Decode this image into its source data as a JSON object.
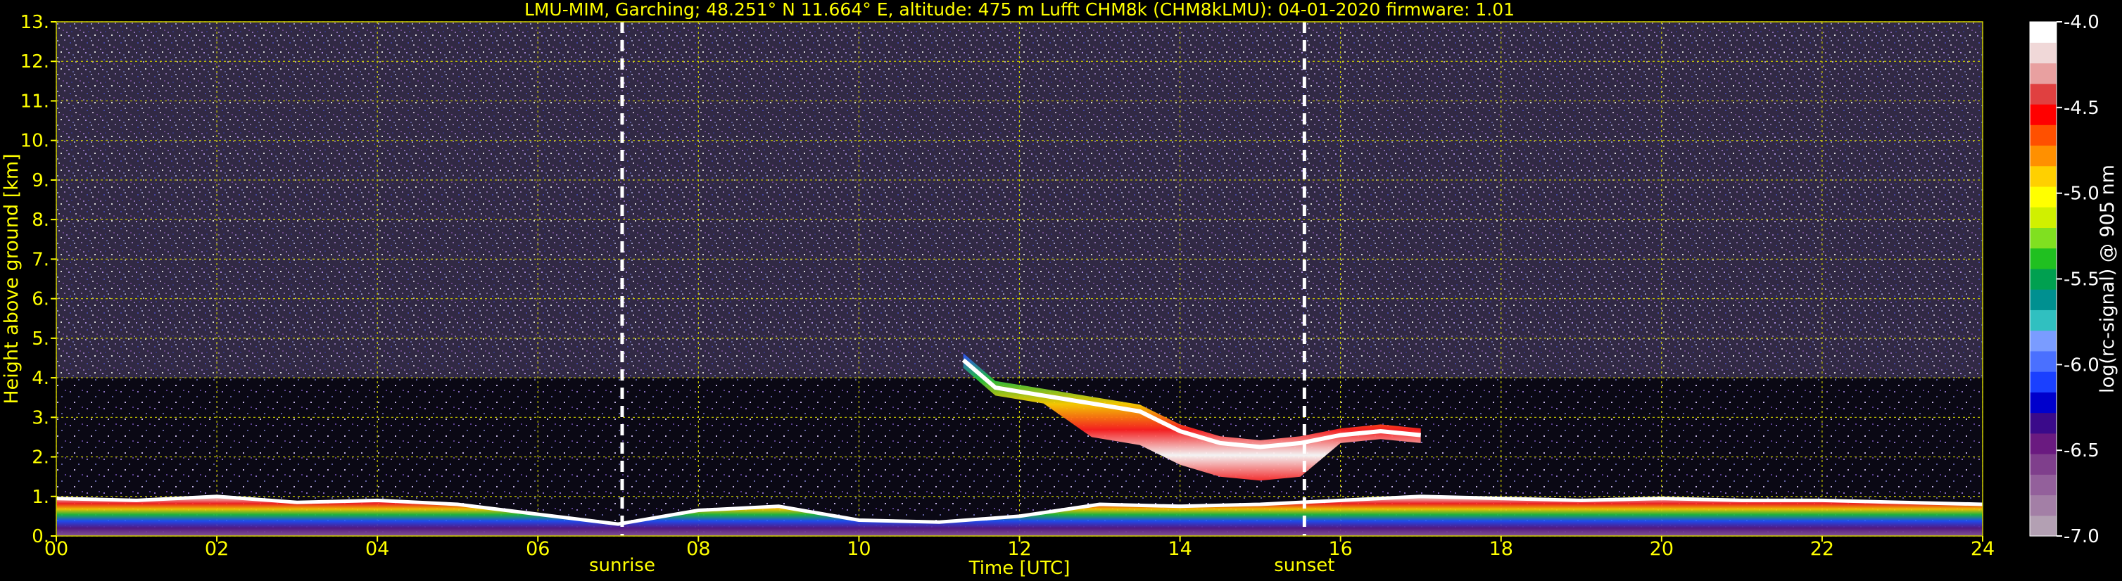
{
  "chart_data": {
    "type": "heatmap",
    "title": "LMU-MIM, Garching; 48.251° N 11.664° E, altitude: 475 m    Lufft CHM8k (CHM8kLMU): 04-01-2020    firmware: 1.01",
    "xlabel": "Time [UTC]",
    "ylabel": "Height above ground [km]",
    "xlim": [
      0,
      24
    ],
    "ylim": [
      0,
      13
    ],
    "x_ticks": [
      "00",
      "02",
      "04",
      "06",
      "08",
      "10",
      "12",
      "14",
      "16",
      "18",
      "20",
      "22",
      "24"
    ],
    "y_ticks": [
      "0.",
      "1.",
      "2.",
      "3.",
      "4.",
      "5.",
      "6.",
      "7.",
      "8.",
      "9.",
      "10.",
      "11.",
      "12.",
      "13."
    ],
    "grid": true,
    "grid_color": "#cccc00",
    "events": [
      {
        "label": "sunrise",
        "time": 7.05
      },
      {
        "label": "sunset",
        "time": 15.55
      }
    ],
    "colorbar": {
      "label": "log(rc-signal) @ 905 nm",
      "ticks": [
        "-4.0",
        "-4.5",
        "-5.0",
        "-5.5",
        "-6.0",
        "-6.5",
        "-7.0"
      ],
      "range": [
        -7.0,
        -4.0
      ],
      "colors": [
        "#b3a0b3",
        "#a37fa6",
        "#93609b",
        "#7f3f8c",
        "#6a1a80",
        "#3a0a8a",
        "#0000cc",
        "#1a40ff",
        "#4a70ff",
        "#7a9cff",
        "#30c0c0",
        "#009090",
        "#00a050",
        "#20c020",
        "#80e020",
        "#d0f000",
        "#ffff00",
        "#ffd000",
        "#ff9000",
        "#ff5000",
        "#ff0000",
        "#e04040",
        "#e8a0a0",
        "#f0d8d8",
        "#ffffff"
      ]
    },
    "boundary_layer_top_km": [
      [
        0.0,
        0.95
      ],
      [
        1.0,
        0.9
      ],
      [
        2.0,
        1.0
      ],
      [
        3.0,
        0.85
      ],
      [
        4.0,
        0.9
      ],
      [
        5.0,
        0.8
      ],
      [
        6.0,
        0.55
      ],
      [
        7.0,
        0.3
      ],
      [
        8.0,
        0.65
      ],
      [
        9.0,
        0.75
      ],
      [
        10.0,
        0.4
      ],
      [
        11.0,
        0.35
      ],
      [
        12.0,
        0.5
      ],
      [
        13.0,
        0.8
      ],
      [
        14.0,
        0.75
      ],
      [
        15.0,
        0.8
      ],
      [
        16.0,
        0.9
      ],
      [
        17.0,
        1.0
      ],
      [
        18.0,
        0.95
      ],
      [
        19.0,
        0.9
      ],
      [
        20.0,
        0.95
      ],
      [
        21.0,
        0.9
      ],
      [
        22.0,
        0.9
      ],
      [
        23.0,
        0.85
      ],
      [
        24.0,
        0.8
      ]
    ],
    "cloud_layer_km": [
      [
        11.3,
        4.5
      ],
      [
        11.7,
        3.8
      ],
      [
        12.3,
        3.6
      ],
      [
        12.9,
        3.4
      ],
      [
        13.5,
        3.2
      ],
      [
        14.0,
        2.7
      ],
      [
        14.5,
        2.4
      ],
      [
        15.0,
        2.3
      ],
      [
        15.5,
        2.4
      ],
      [
        16.0,
        2.6
      ],
      [
        16.5,
        2.7
      ],
      [
        17.0,
        2.6
      ]
    ]
  }
}
